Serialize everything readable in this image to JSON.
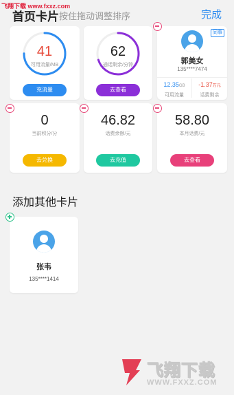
{
  "watermark_top": "飞翔下载 www.fxxz.com",
  "header": {
    "title": "首页卡片",
    "hint": "按住拖动调整排序",
    "done": "完成"
  },
  "cards": {
    "data": {
      "value": "41",
      "unit": "可用流量/MB",
      "button": "充流量",
      "ring_fraction": 0.75
    },
    "call": {
      "value": "62",
      "unit": "通话剩余/分钟",
      "button": "去查看",
      "ring_fraction": 0.7
    },
    "contact": {
      "badge": "同事",
      "name": "郭美女",
      "phone": "135****7474",
      "data_value": "12.35",
      "data_unit": "GB",
      "data_label": "可用流量",
      "balance_value": "-1.37",
      "balance_unit": "万元",
      "balance_label": "话费剩余"
    },
    "points": {
      "value": "0",
      "unit": "当前积分/分",
      "button": "去兑换"
    },
    "balance": {
      "value": "46.82",
      "unit": "话费余额/元",
      "button": "去充值"
    },
    "bill": {
      "value": "58.80",
      "unit": "本月话费/元",
      "button": "去查看"
    }
  },
  "other_section": {
    "title": "添加其他卡片"
  },
  "other_card": {
    "name": "张韦",
    "phone": "135****1414"
  },
  "watermark_bottom": {
    "brand": "飞翔下载",
    "url": "WWW.FXXZ.COM"
  },
  "colors": {
    "blue": "#2d8cf0",
    "purple": "#8b2fd8",
    "yellow": "#f5b800",
    "green": "#1fc8a0",
    "pink": "#e8407a",
    "red": "#e74c3c"
  }
}
